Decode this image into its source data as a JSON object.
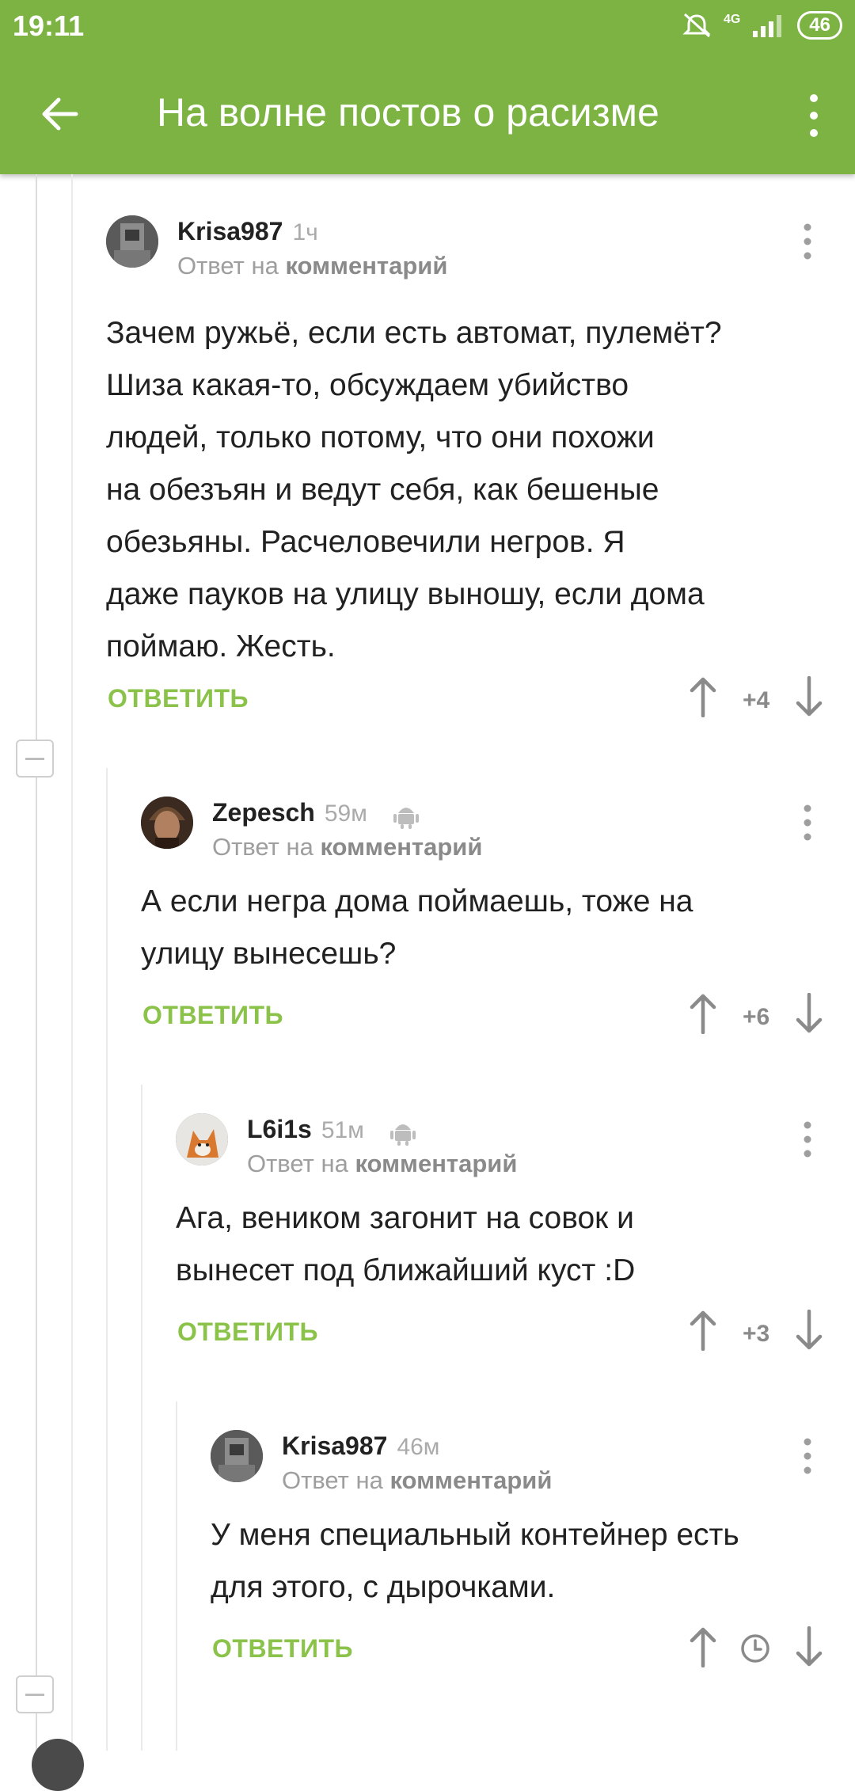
{
  "status": {
    "time": "19:11",
    "network": "4G",
    "battery": "46"
  },
  "appbar": {
    "title": "На волне постов о расизме"
  },
  "reply_prefix": "Ответ на",
  "reply_target": "комментарий",
  "reply_label": "ОТВЕТИТЬ",
  "comments": [
    {
      "author": "Krisa987",
      "time": "1ч",
      "lines": [
        "Зачем ружьё, если есть автомат, пулемёт?",
        "Шиза какая-то, обсуждаем убийство",
        "людей, только потому, что они похожи",
        "на обезъян и ведут себя, как бешеные",
        "обезьяны. Расчеловечили негров. Я",
        "даже пауков на улицу выношу, если дома",
        "поймаю. Жесть."
      ],
      "score": "+4"
    },
    {
      "author": "Zepesch",
      "time": "59м",
      "lines": [
        "А если негра дома поймаешь, тоже на",
        "улицу вынесешь?"
      ],
      "score": "+6"
    },
    {
      "author": "L6i1s",
      "time": "51м",
      "lines": [
        "Ага, веником загонит на совок и",
        "вынесет под ближайший куст :D"
      ],
      "score": "+3"
    },
    {
      "author": "Krisa987",
      "time": "46м",
      "lines": [
        "У меня специальный контейнер есть",
        "для этого, с дырочками."
      ],
      "score": ""
    }
  ]
}
